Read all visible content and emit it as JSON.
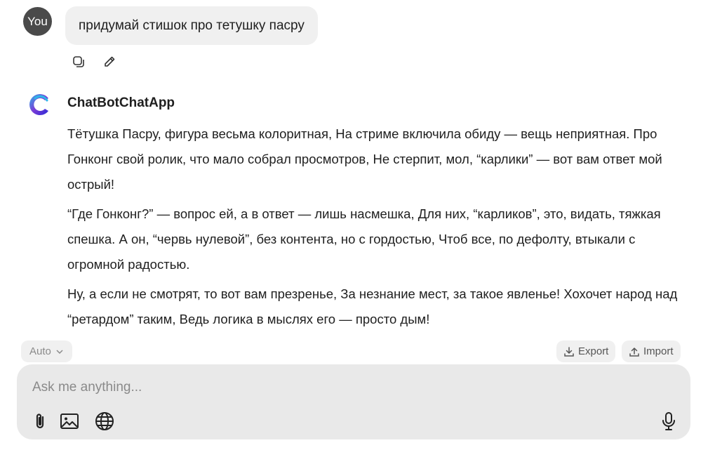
{
  "user": {
    "avatar_label": "You",
    "message": "придумай стишок про тетушку пасру"
  },
  "bot": {
    "name": "ChatBotChatApp",
    "paragraphs": [
      "Тётушка Пасру, фигура весьма колоритная, На стриме включила обиду — вещь неприятная. Про Гонконг свой ролик, что мало собрал просмотров, Не стерпит, мол, “карлики” — вот вам ответ мой острый!",
      "“Где Гонконг?” — вопрос ей, а в ответ — лишь насмешка, Для них, “карликов”, это, видать, тяжкая спешка. А он, “червь нулевой”, без контента, но с гордостью, Чтоб все, по дефолту, втыкали с огромной радостью.",
      "Ну, а если не смотрят, то вот вам презренье, За незнание мест, за такое явленье! Хохочет народ над “ретардом” таким, Ведь логика в мыслях его — просто дым!"
    ]
  },
  "toolbar": {
    "mode_label": "Auto",
    "export_label": "Export",
    "import_label": "Import"
  },
  "composer": {
    "placeholder": "Ask me anything..."
  },
  "colors": {
    "bubble": "#f0f0f0",
    "composer": "#e9e9e9",
    "avatar": "#4a4a4a",
    "logo_gradient": [
      "#2b2bd6",
      "#8a3bd1",
      "#2fb6e8"
    ]
  }
}
